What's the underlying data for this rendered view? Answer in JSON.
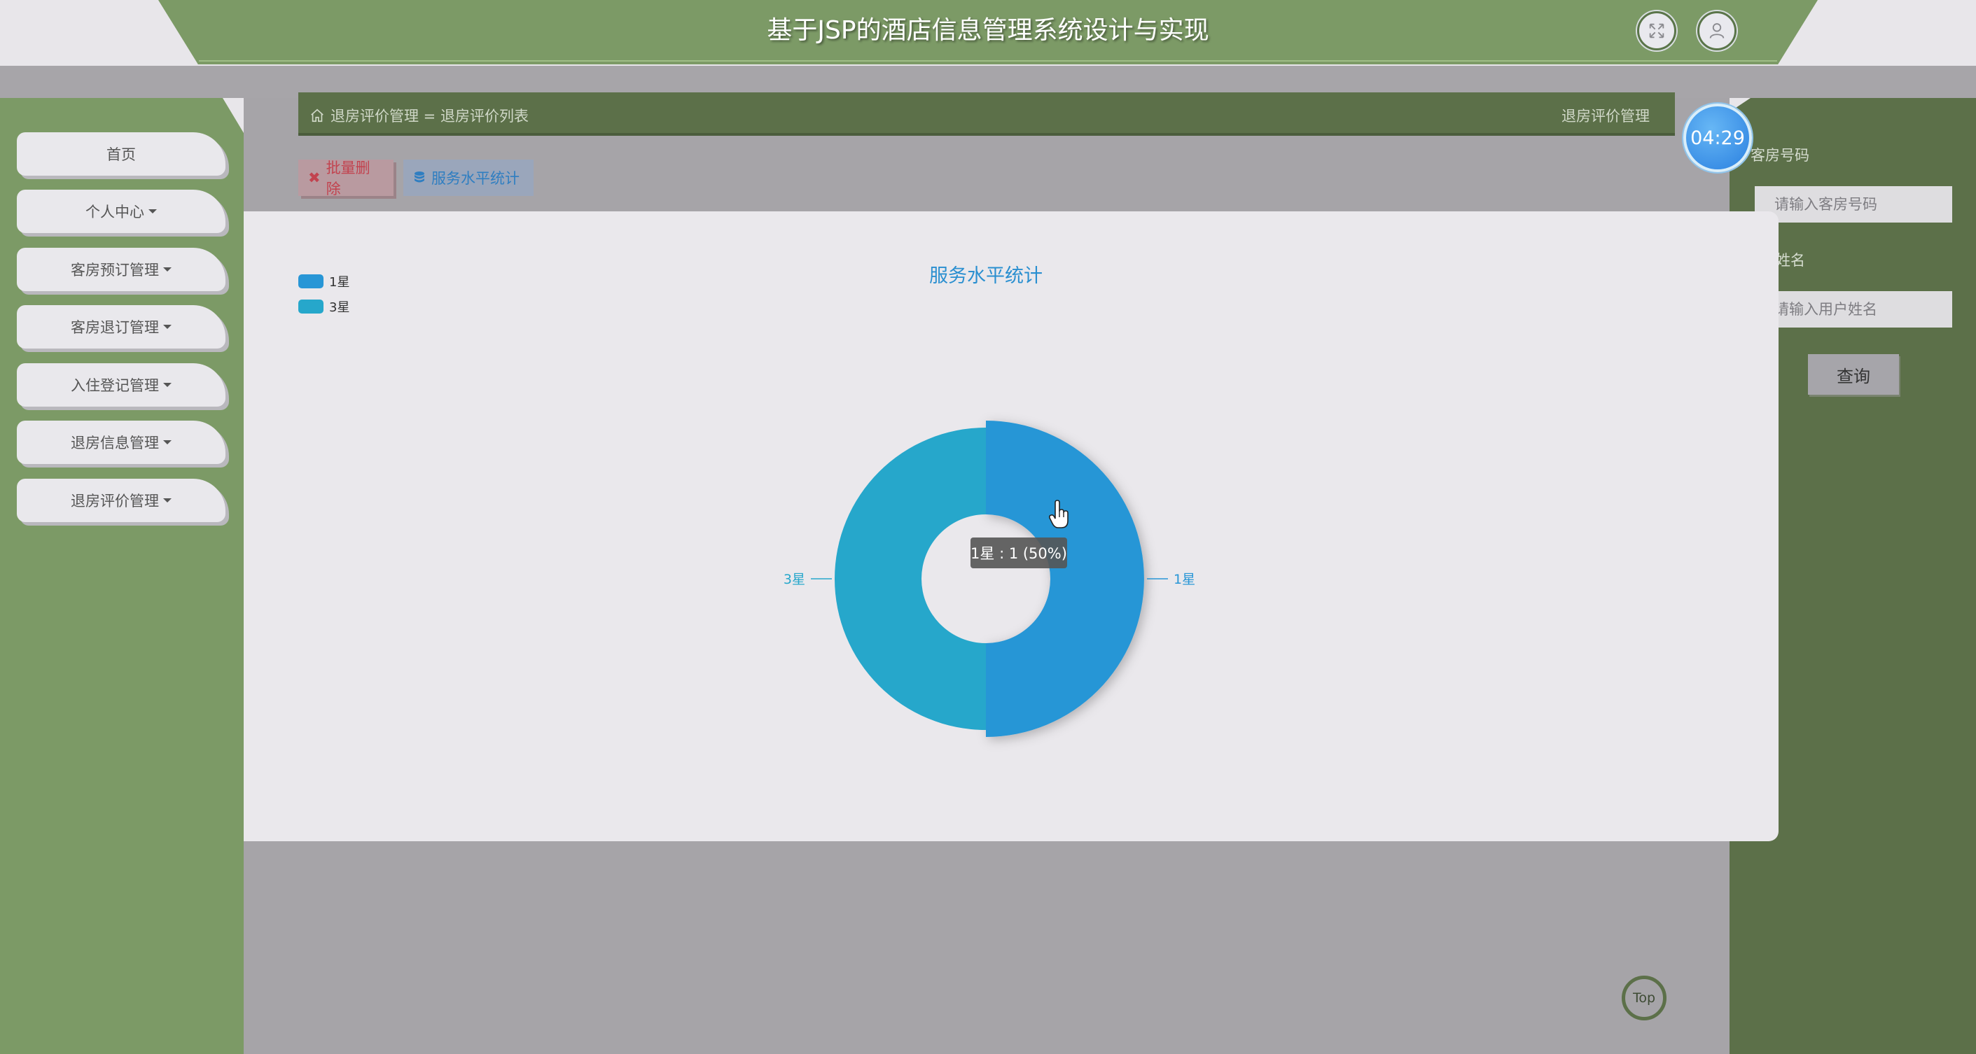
{
  "header": {
    "title": "基于JSP的酒店信息管理系统设计与实现",
    "fullscreen_icon": "fullscreen-icon",
    "user_icon": "user-icon"
  },
  "sidebar": {
    "items": [
      {
        "label": "首页",
        "dropdown": false
      },
      {
        "label": "个人中心",
        "dropdown": true
      },
      {
        "label": "客房预订管理",
        "dropdown": true
      },
      {
        "label": "客房退订管理",
        "dropdown": true
      },
      {
        "label": "入住登记管理",
        "dropdown": true
      },
      {
        "label": "退房信息管理",
        "dropdown": true
      },
      {
        "label": "退房评价管理",
        "dropdown": true
      }
    ]
  },
  "breadcrumb": {
    "icon": "home-icon",
    "path": "退房评价管理 = 退房评价列表",
    "right": "退房评价管理"
  },
  "toolbar": {
    "delete_label": "批量删除",
    "stats_label": "服务水平统计"
  },
  "search": {
    "room_label": "客房号码",
    "room_placeholder": "请输入客房号码",
    "name_label": "姓名",
    "name_placeholder": "请输入用户姓名",
    "button": "查询"
  },
  "clock": "04:29",
  "top_button": "Top",
  "chart_data": {
    "type": "pie",
    "title": "服务水平统计",
    "categories": [
      "1星",
      "3星"
    ],
    "values": [
      1,
      1
    ],
    "colors": [
      "#2896d6",
      "#26a7cb"
    ],
    "legend": "top-left",
    "donut": true,
    "tooltip": "1星 : 1 (50%)"
  }
}
